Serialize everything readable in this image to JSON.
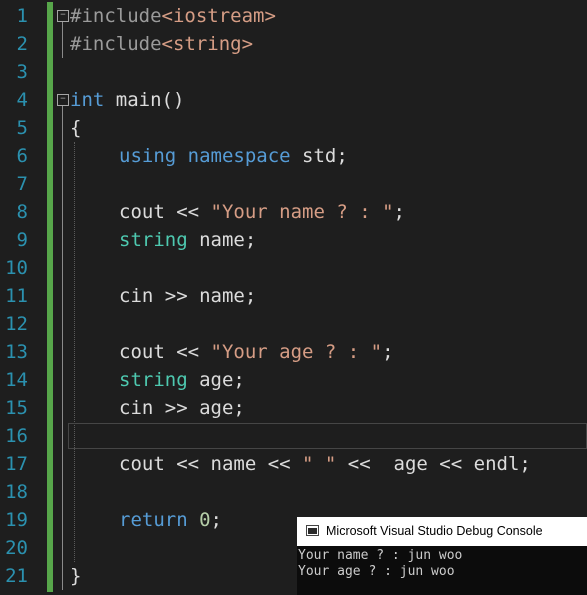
{
  "editor": {
    "line_numbers": [
      "1",
      "2",
      "3",
      "4",
      "5",
      "6",
      "7",
      "8",
      "9",
      "10",
      "11",
      "12",
      "13",
      "14",
      "15",
      "16",
      "17",
      "18",
      "19",
      "20",
      "21"
    ],
    "code": {
      "l1": {
        "kw": "#include",
        "inc": "<iostream>"
      },
      "l2": {
        "kw": "#include",
        "inc": "<string>"
      },
      "l4": {
        "kw": "int",
        "rest": " main()"
      },
      "l5": {
        "text": "{"
      },
      "l6": {
        "kw1": "using",
        "kw2": "namespace",
        "rest": " std;"
      },
      "l8": {
        "pre": "cout << ",
        "str": "\"Your name ? : \"",
        "post": ";"
      },
      "l9": {
        "ty": "string",
        "rest": " name;"
      },
      "l11": {
        "text": "cin >> name;"
      },
      "l13": {
        "pre": "cout << ",
        "str": "\"Your age ? : \"",
        "post": ";"
      },
      "l14": {
        "ty": "string",
        "rest": " age;"
      },
      "l15": {
        "text": "cin >> age;"
      },
      "l17": {
        "pre": "cout << name << ",
        "str": "\" \"",
        "post": " <<  age << endl;"
      },
      "l19": {
        "kw": "return",
        "num": "0",
        "post": ";"
      },
      "l21": {
        "text": "}"
      }
    }
  },
  "console": {
    "title": "Microsoft Visual Studio Debug Console",
    "lines": [
      "Your name ? : jun woo",
      "Your age ? : jun woo"
    ]
  },
  "colors": {
    "background": "#1e1e1e",
    "line_number": "#2b91af",
    "keyword": "#569cd6",
    "type": "#4ec9b0",
    "string": "#d69d85",
    "number": "#b5cea8",
    "text": "#dcdcdc",
    "change_bar": "#57a64a"
  },
  "icons": [
    "collapse-icon",
    "console-app-icon"
  ]
}
